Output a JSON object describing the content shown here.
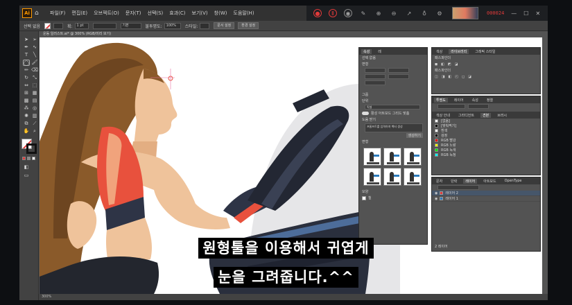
{
  "menubar": {
    "logo": "Ai",
    "items": [
      "파일(F)",
      "편집(E)",
      "오브젝트(O)",
      "문자(T)",
      "선택(S)",
      "효과(C)",
      "보기(V)",
      "창(W)",
      "도움말(H)"
    ]
  },
  "recorder": {
    "time": "000024"
  },
  "controlbar": {
    "selection_label": "선택 없음",
    "stroke_label": "획:",
    "stroke_value": "1 pt",
    "style_label": "기본",
    "opacity_label": "불투명도:",
    "opacity_value": "100%",
    "style2_label": "스타일:",
    "doc_setup_btn": "문서 설정",
    "prefs_btn": "환경 설정"
  },
  "document": {
    "tab_title": "운동 일러스트.ai* @ 300% (RGB/미리 보기)",
    "status_zoom": "300%"
  },
  "properties_panel": {
    "tabs": [
      "속성",
      "레"
    ],
    "no_selection": "선택 없음",
    "transform": "변형",
    "unit_label": "단위",
    "unit_value": "픽셀",
    "snap_label": "펜 도구 바로 그리기",
    "group_label": "그룹",
    "toggle_label": "활성 아트보드 그리드 맞춤",
    "swatch_section": "도형",
    "generate_label": "도움 받기",
    "generate_desc": "프롬프트를 입력하여 벡터 생성",
    "generate_btn": "생성하기",
    "thumbs_label": "변형",
    "footer_label": "모양",
    "footer_value": "칠"
  },
  "libraries_panel": {
    "tabs": [
      "색상",
      "라이브러리",
      "그래픽 스타일"
    ],
    "title": "패스파인더",
    "section2": "패스파인더"
  },
  "swatches_panel": {
    "tabs": [
      "투명도",
      "레이어",
      "속성",
      "정렬"
    ],
    "sub_tabs": [
      "색상 안내",
      "그라디언트",
      "견본",
      "브러시"
    ],
    "items": [
      {
        "label": "[없음]",
        "color": "#ffffff"
      },
      {
        "label": "[맞춰찍기]",
        "color": "#000000"
      },
      {
        "label": "흰색",
        "color": "#ffffff"
      },
      {
        "label": "검정",
        "color": "#000000"
      },
      {
        "label": "RGB 빨강",
        "color": "#ff0000"
      },
      {
        "label": "RGB 노랑",
        "color": "#ffff00"
      },
      {
        "label": "RGB 녹색",
        "color": "#00ff00"
      },
      {
        "label": "RGB 녹청",
        "color": "#00ffff"
      }
    ]
  },
  "layers_panel": {
    "tabs": [
      "문자",
      "단락",
      "레이어",
      "아트보드",
      "OpenType"
    ],
    "items": [
      "레이어 2",
      "레이어 1"
    ],
    "footer": "2 레이어"
  },
  "subtitles": {
    "line1": "원형툴을 이용해서 귀엽게",
    "line2": "눈을 그려줍니다.^^"
  },
  "colors": {
    "ui_dark": "#323232",
    "ui_mid": "#424242",
    "ui_panel": "#535353",
    "accent_red": "#e03a3a"
  }
}
